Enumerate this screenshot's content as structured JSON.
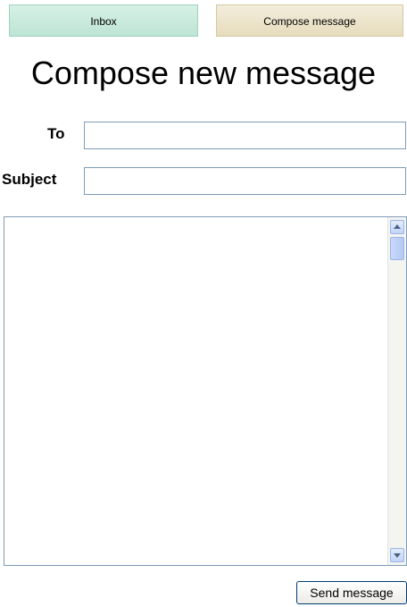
{
  "tabs": {
    "inbox": "Inbox",
    "compose": "Compose message"
  },
  "page": {
    "title": "Compose new message"
  },
  "form": {
    "to_label": "To",
    "to_value": "",
    "subject_label": "Subject",
    "subject_value": "",
    "body_value": "",
    "send_label": "Send message"
  },
  "colors": {
    "inbox_tab": "#bde5d5",
    "compose_tab": "#e6dcbd",
    "field_border": "#7f9db9"
  }
}
